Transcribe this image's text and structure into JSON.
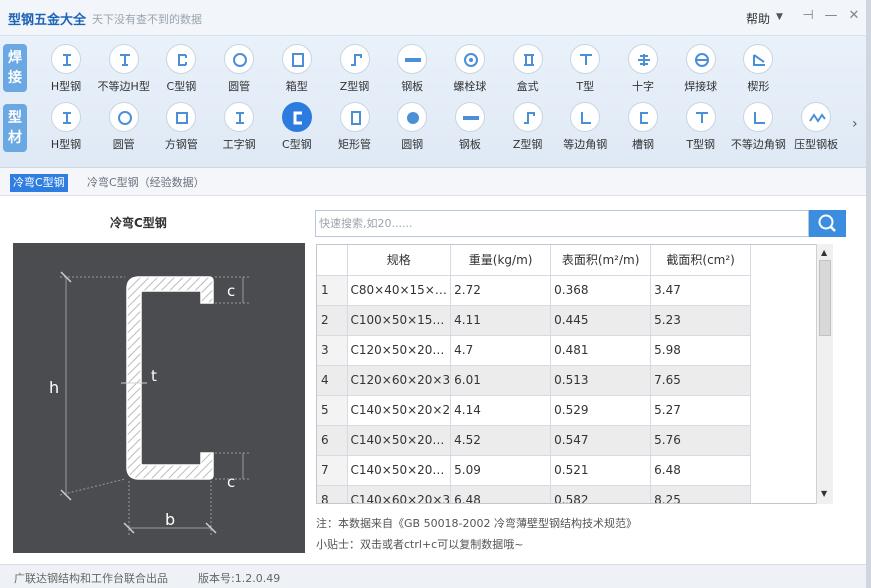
{
  "app": {
    "title": "型钢五金大全",
    "subtitle": "天下没有查不到的数据",
    "help": "帮助"
  },
  "groups": {
    "weld_tag": "焊接",
    "profile_tag": "型材"
  },
  "weld_tools": [
    {
      "label": "H型钢",
      "icon": "h-beam-icon"
    },
    {
      "label": "不等边H型",
      "icon": "unequal-h-icon"
    },
    {
      "label": "C型钢",
      "icon": "c-channel-icon"
    },
    {
      "label": "圆管",
      "icon": "round-tube-icon"
    },
    {
      "label": "箱型",
      "icon": "box-section-icon"
    },
    {
      "label": "Z型钢",
      "icon": "z-section-icon"
    },
    {
      "label": "钢板",
      "icon": "steel-plate-icon"
    },
    {
      "label": "螺栓球",
      "icon": "bolt-ball-icon"
    },
    {
      "label": "盒式",
      "icon": "box-type-icon"
    },
    {
      "label": "T型",
      "icon": "t-section-icon"
    },
    {
      "label": "十字",
      "icon": "cross-section-icon"
    },
    {
      "label": "焊接球",
      "icon": "welded-ball-icon"
    },
    {
      "label": "楔形",
      "icon": "wedge-icon"
    }
  ],
  "profile_tools": [
    {
      "label": "H型钢",
      "icon": "h-beam-icon"
    },
    {
      "label": "圆管",
      "icon": "round-tube-icon"
    },
    {
      "label": "方钢管",
      "icon": "square-tube-icon"
    },
    {
      "label": "工字钢",
      "icon": "i-beam-icon"
    },
    {
      "label": "C型钢",
      "icon": "c-channel-icon"
    },
    {
      "label": "矩形管",
      "icon": "rect-tube-icon"
    },
    {
      "label": "圆钢",
      "icon": "round-bar-icon"
    },
    {
      "label": "钢板",
      "icon": "steel-plate-icon"
    },
    {
      "label": "Z型钢",
      "icon": "z-section-icon"
    },
    {
      "label": "等边角钢",
      "icon": "equal-angle-icon"
    },
    {
      "label": "槽钢",
      "icon": "channel-icon"
    },
    {
      "label": "T型钢",
      "icon": "t-section-icon"
    },
    {
      "label": "不等边角钢",
      "icon": "unequal-angle-icon"
    },
    {
      "label": "压型钢板",
      "icon": "profiled-sheet-icon"
    }
  ],
  "subtabs": [
    "冷弯C型钢",
    "冷弯C型钢（经验数据）"
  ],
  "shape": {
    "title": "冷弯C型钢",
    "labels": {
      "h": "h",
      "b": "b",
      "c_top": "c",
      "c_bottom": "c",
      "t": "t"
    }
  },
  "search": {
    "placeholder": "快速搜索,如20......"
  },
  "table": {
    "headers": [
      "规格",
      "重量(kg/m)",
      "表面积(m²/m)",
      "截面积(cm²)"
    ],
    "rows": [
      {
        "n": "1",
        "spec": "C80×40×15×…",
        "weight": "2.72",
        "surface": "0.368",
        "area": "3.47"
      },
      {
        "n": "2",
        "spec": "C100×50×15…",
        "weight": "4.11",
        "surface": "0.445",
        "area": "5.23"
      },
      {
        "n": "3",
        "spec": "C120×50×20…",
        "weight": "4.7",
        "surface": "0.481",
        "area": "5.98"
      },
      {
        "n": "4",
        "spec": "C120×60×20×3",
        "weight": "6.01",
        "surface": "0.513",
        "area": "7.65"
      },
      {
        "n": "5",
        "spec": "C140×50×20×2",
        "weight": "4.14",
        "surface": "0.529",
        "area": "5.27"
      },
      {
        "n": "6",
        "spec": "C140×50×20…",
        "weight": "4.52",
        "surface": "0.547",
        "area": "5.76"
      },
      {
        "n": "7",
        "spec": "C140×50×20…",
        "weight": "5.09",
        "surface": "0.521",
        "area": "6.48"
      },
      {
        "n": "8",
        "spec": "C140×60×20×3",
        "weight": "6.48",
        "surface": "0.582",
        "area": "8.25"
      }
    ]
  },
  "notes": {
    "source": "注：本数据来自《GB  50018-2002  冷弯薄壁型钢结构技术规范》",
    "tip": "小贴士：双击或者ctrl+c可以复制数据哦~"
  },
  "footer": {
    "credit": "广联达钢结构和工作台联合出品",
    "version": "版本号:1.2.0.49"
  },
  "colors": {
    "accent": "#2e7de0",
    "brand": "#1e63b8",
    "panel": "#4b4c50"
  }
}
